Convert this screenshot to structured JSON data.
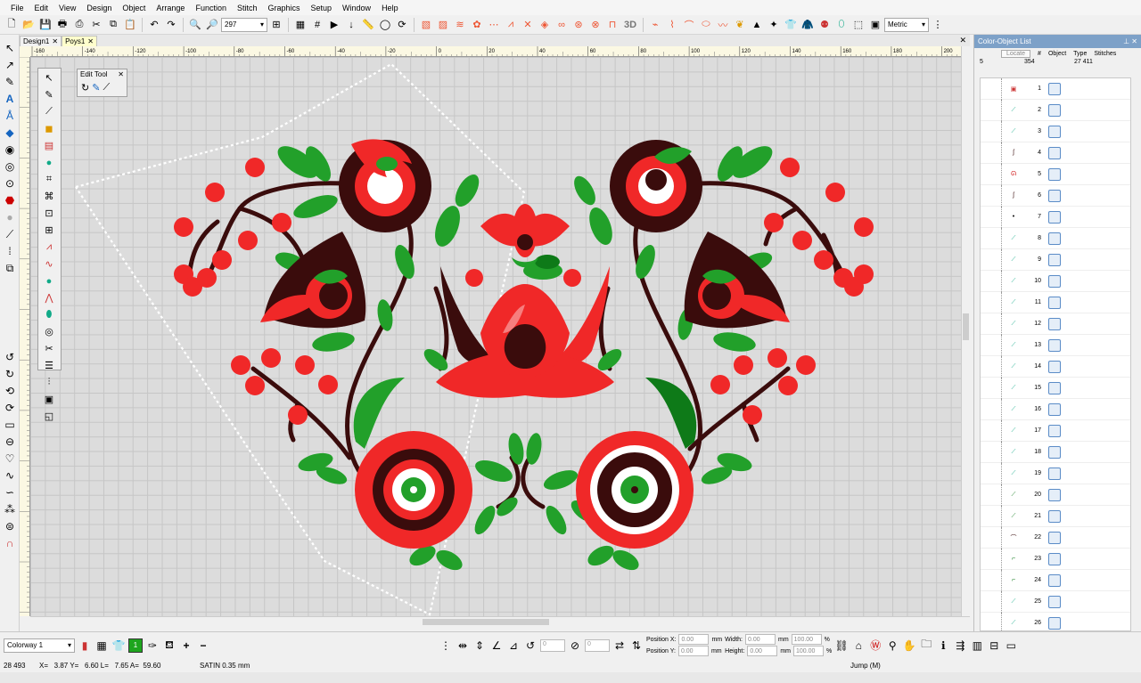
{
  "menu": [
    "File",
    "Edit",
    "View",
    "Design",
    "Object",
    "Arrange",
    "Function",
    "Stitch",
    "Graphics",
    "Setup",
    "Window",
    "Help"
  ],
  "toolbar": {
    "zoom_value": "297",
    "units": "Metric",
    "three_d": "3D"
  },
  "tabs": [
    {
      "label": "Design1",
      "active": false
    },
    {
      "label": "Poys1",
      "active": true
    }
  ],
  "ruler": {
    "h_ticks": [
      "-160",
      "-140",
      "-120",
      "-100",
      "-80",
      "-60",
      "-40",
      "-20",
      "0",
      "20",
      "40",
      "60",
      "80",
      "100",
      "120",
      "140",
      "160",
      "180",
      "200"
    ]
  },
  "edit_tool": {
    "title": "Edit Tool"
  },
  "panel": {
    "title": "Color-Object List",
    "locate": "Locate",
    "headers": {
      "num": "#",
      "object": "Object",
      "type": "Type",
      "stitches": "Stitches"
    },
    "totals": {
      "colors": "5",
      "objects": "354",
      "stitches": "27 411"
    },
    "rows": [
      "1",
      "2",
      "3",
      "4",
      "5",
      "6",
      "7",
      "8",
      "9",
      "10",
      "11",
      "12",
      "13",
      "14",
      "15",
      "16",
      "17",
      "18",
      "19",
      "20",
      "21",
      "22",
      "23",
      "24",
      "25",
      "26"
    ]
  },
  "bottom": {
    "colorway": "Colorway 1",
    "color_number": "1",
    "rotate_value": "0",
    "slant_value": "0",
    "pos_x_label": "Position X:",
    "pos_y_label": "Position Y:",
    "pos_x": "0.00",
    "pos_y": "0.00",
    "width_label": "Width:",
    "height_label": "Height:",
    "width": "0.00",
    "height": "0.00",
    "unit": "mm",
    "width_pct": "100.00",
    "height_pct": "100.00",
    "pct": "%"
  },
  "status": {
    "stitches": "28 493",
    "coords": "X=   3.87 Y=   6.60 L=   7.65 A=  59.60",
    "stitch_type": "SATIN  0.35 mm",
    "mode": "Jump (M)"
  },
  "colors": {
    "red": "#f02828",
    "dark": "#3a0c0c",
    "green": "#22a02a",
    "darkgreen": "#0e7a18"
  }
}
